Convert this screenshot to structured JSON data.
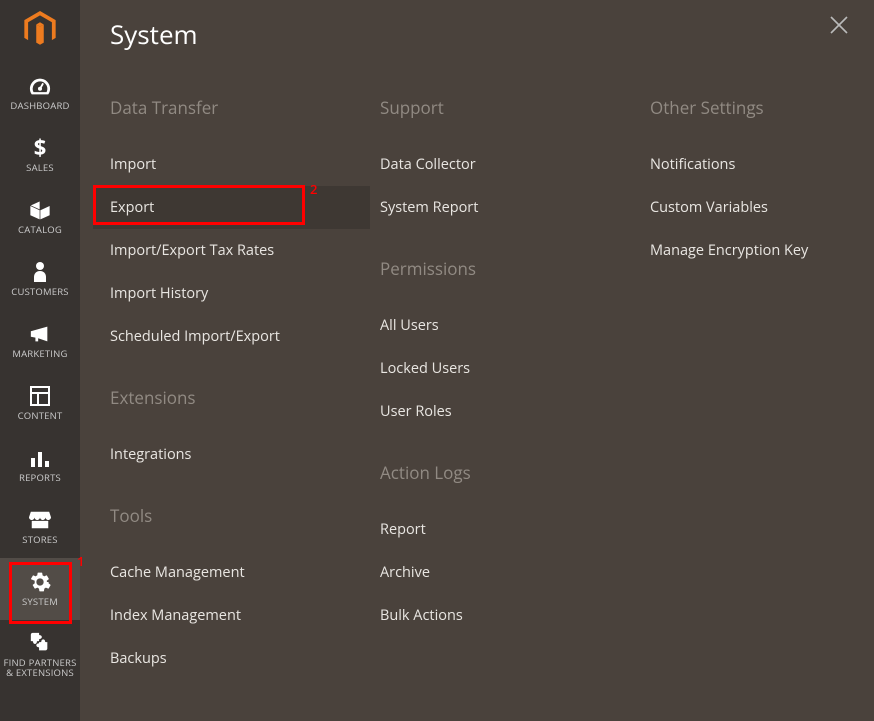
{
  "sidebar": {
    "items": [
      {
        "label": "DASHBOARD"
      },
      {
        "label": "SALES"
      },
      {
        "label": "CATALOG"
      },
      {
        "label": "CUSTOMERS"
      },
      {
        "label": "MARKETING"
      },
      {
        "label": "CONTENT"
      },
      {
        "label": "REPORTS"
      },
      {
        "label": "STORES"
      },
      {
        "label": "SYSTEM"
      },
      {
        "label": "FIND PARTNERS & EXTENSIONS"
      }
    ]
  },
  "panel": {
    "title": "System",
    "columns": [
      {
        "sections": [
          {
            "title": "Data Transfer",
            "items": [
              "Import",
              "Export",
              "Import/Export Tax Rates",
              "Import History",
              "Scheduled Import/Export"
            ]
          },
          {
            "title": "Extensions",
            "items": [
              "Integrations"
            ]
          },
          {
            "title": "Tools",
            "items": [
              "Cache Management",
              "Index Management",
              "Backups"
            ]
          }
        ]
      },
      {
        "sections": [
          {
            "title": "Support",
            "items": [
              "Data Collector",
              "System Report"
            ]
          },
          {
            "title": "Permissions",
            "items": [
              "All Users",
              "Locked Users",
              "User Roles"
            ]
          },
          {
            "title": "Action Logs",
            "items": [
              "Report",
              "Archive",
              "Bulk Actions"
            ]
          }
        ]
      },
      {
        "sections": [
          {
            "title": "Other Settings",
            "items": [
              "Notifications",
              "Custom Variables",
              "Manage Encryption Key"
            ]
          }
        ]
      }
    ]
  },
  "annotations": {
    "box1_num": "1",
    "box2_num": "2"
  }
}
